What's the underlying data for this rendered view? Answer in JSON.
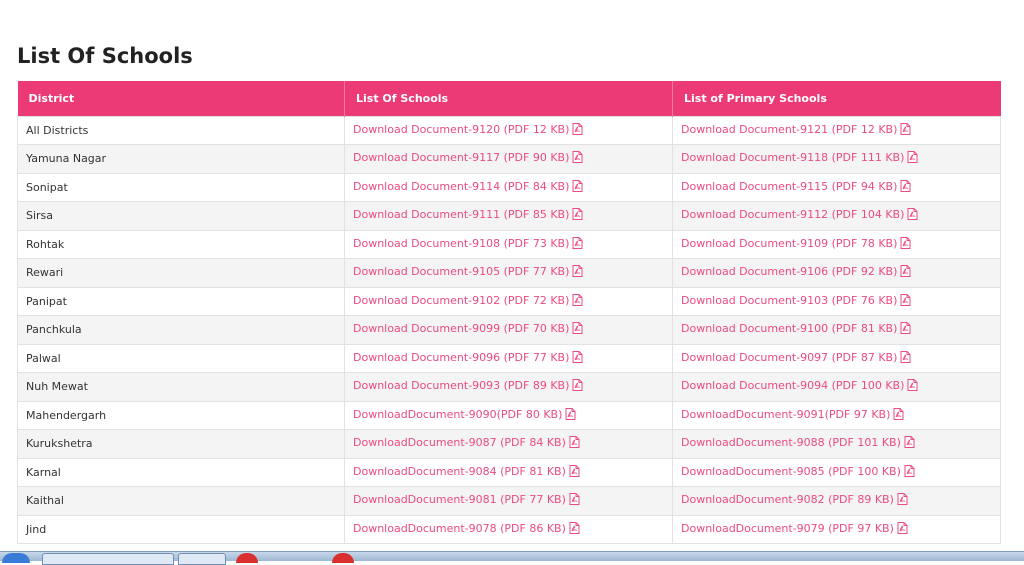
{
  "page": {
    "title": "List Of Schools"
  },
  "colors": {
    "header_bg": "#ec3a76",
    "link": "#ec4b7e",
    "stripe": "#f4f4f4"
  },
  "table": {
    "headers": [
      "District",
      "List Of Schools",
      "List of Primary Schools"
    ],
    "rows": [
      {
        "district": "All Districts",
        "schools": "Download Document-9120 (PDF 12 KB)",
        "primary": "Download Document-9121 (PDF 12 KB)"
      },
      {
        "district": "Yamuna Nagar",
        "schools": "Download Document-9117 (PDF 90 KB)",
        "primary": "Download Document-9118 (PDF 111 KB)"
      },
      {
        "district": "Sonipat",
        "schools": "Download Document-9114 (PDF 84 KB)",
        "primary": "Download Document-9115 (PDF 94 KB)"
      },
      {
        "district": "Sirsa",
        "schools": "Download Document-9111 (PDF 85 KB)",
        "primary": "Download Document-9112 (PDF 104 KB)"
      },
      {
        "district": "Rohtak",
        "schools": "Download Document-9108 (PDF 73 KB)",
        "primary": "Download Document-9109 (PDF 78 KB)"
      },
      {
        "district": "Rewari",
        "schools": "Download Document-9105 (PDF 77 KB)",
        "primary": "Download Document-9106 (PDF 92 KB)"
      },
      {
        "district": "Panipat",
        "schools": "Download Document-9102 (PDF 72 KB)",
        "primary": "Download Document-9103 (PDF 76 KB)"
      },
      {
        "district": "Panchkula",
        "schools": "Download Document-9099 (PDF 70 KB)",
        "primary": "Download Document-9100 (PDF 81 KB)"
      },
      {
        "district": "Palwal",
        "schools": "Download Document-9096 (PDF 77 KB)",
        "primary": "Download Document-9097 (PDF 87 KB)"
      },
      {
        "district": "Nuh Mewat",
        "schools": "Download Document-9093 (PDF 89 KB)",
        "primary": "Download Document-9094 (PDF 100 KB)"
      },
      {
        "district": "Mahendergarh",
        "schools": "DownloadDocument-9090(PDF 80 KB)",
        "primary": "DownloadDocument-9091(PDF 97 KB)"
      },
      {
        "district": "Kurukshetra",
        "schools": "DownloadDocument-9087 (PDF 84 KB)",
        "primary": "DownloadDocument-9088 (PDF 101 KB)"
      },
      {
        "district": "Karnal",
        "schools": "DownloadDocument-9084 (PDF 81 KB)",
        "primary": "DownloadDocument-9085 (PDF 100 KB)"
      },
      {
        "district": "Kaithal",
        "schools": "DownloadDocument-9081 (PDF 77 KB)",
        "primary": "DownloadDocument-9082 (PDF 89 KB)"
      },
      {
        "district": "Jind",
        "schools": "DownloadDocument-9078 (PDF 86 KB)",
        "primary": "DownloadDocument-9079 (PDF 97 KB)"
      }
    ]
  },
  "icons": {
    "doc_icon": "pdf-file-icon"
  }
}
